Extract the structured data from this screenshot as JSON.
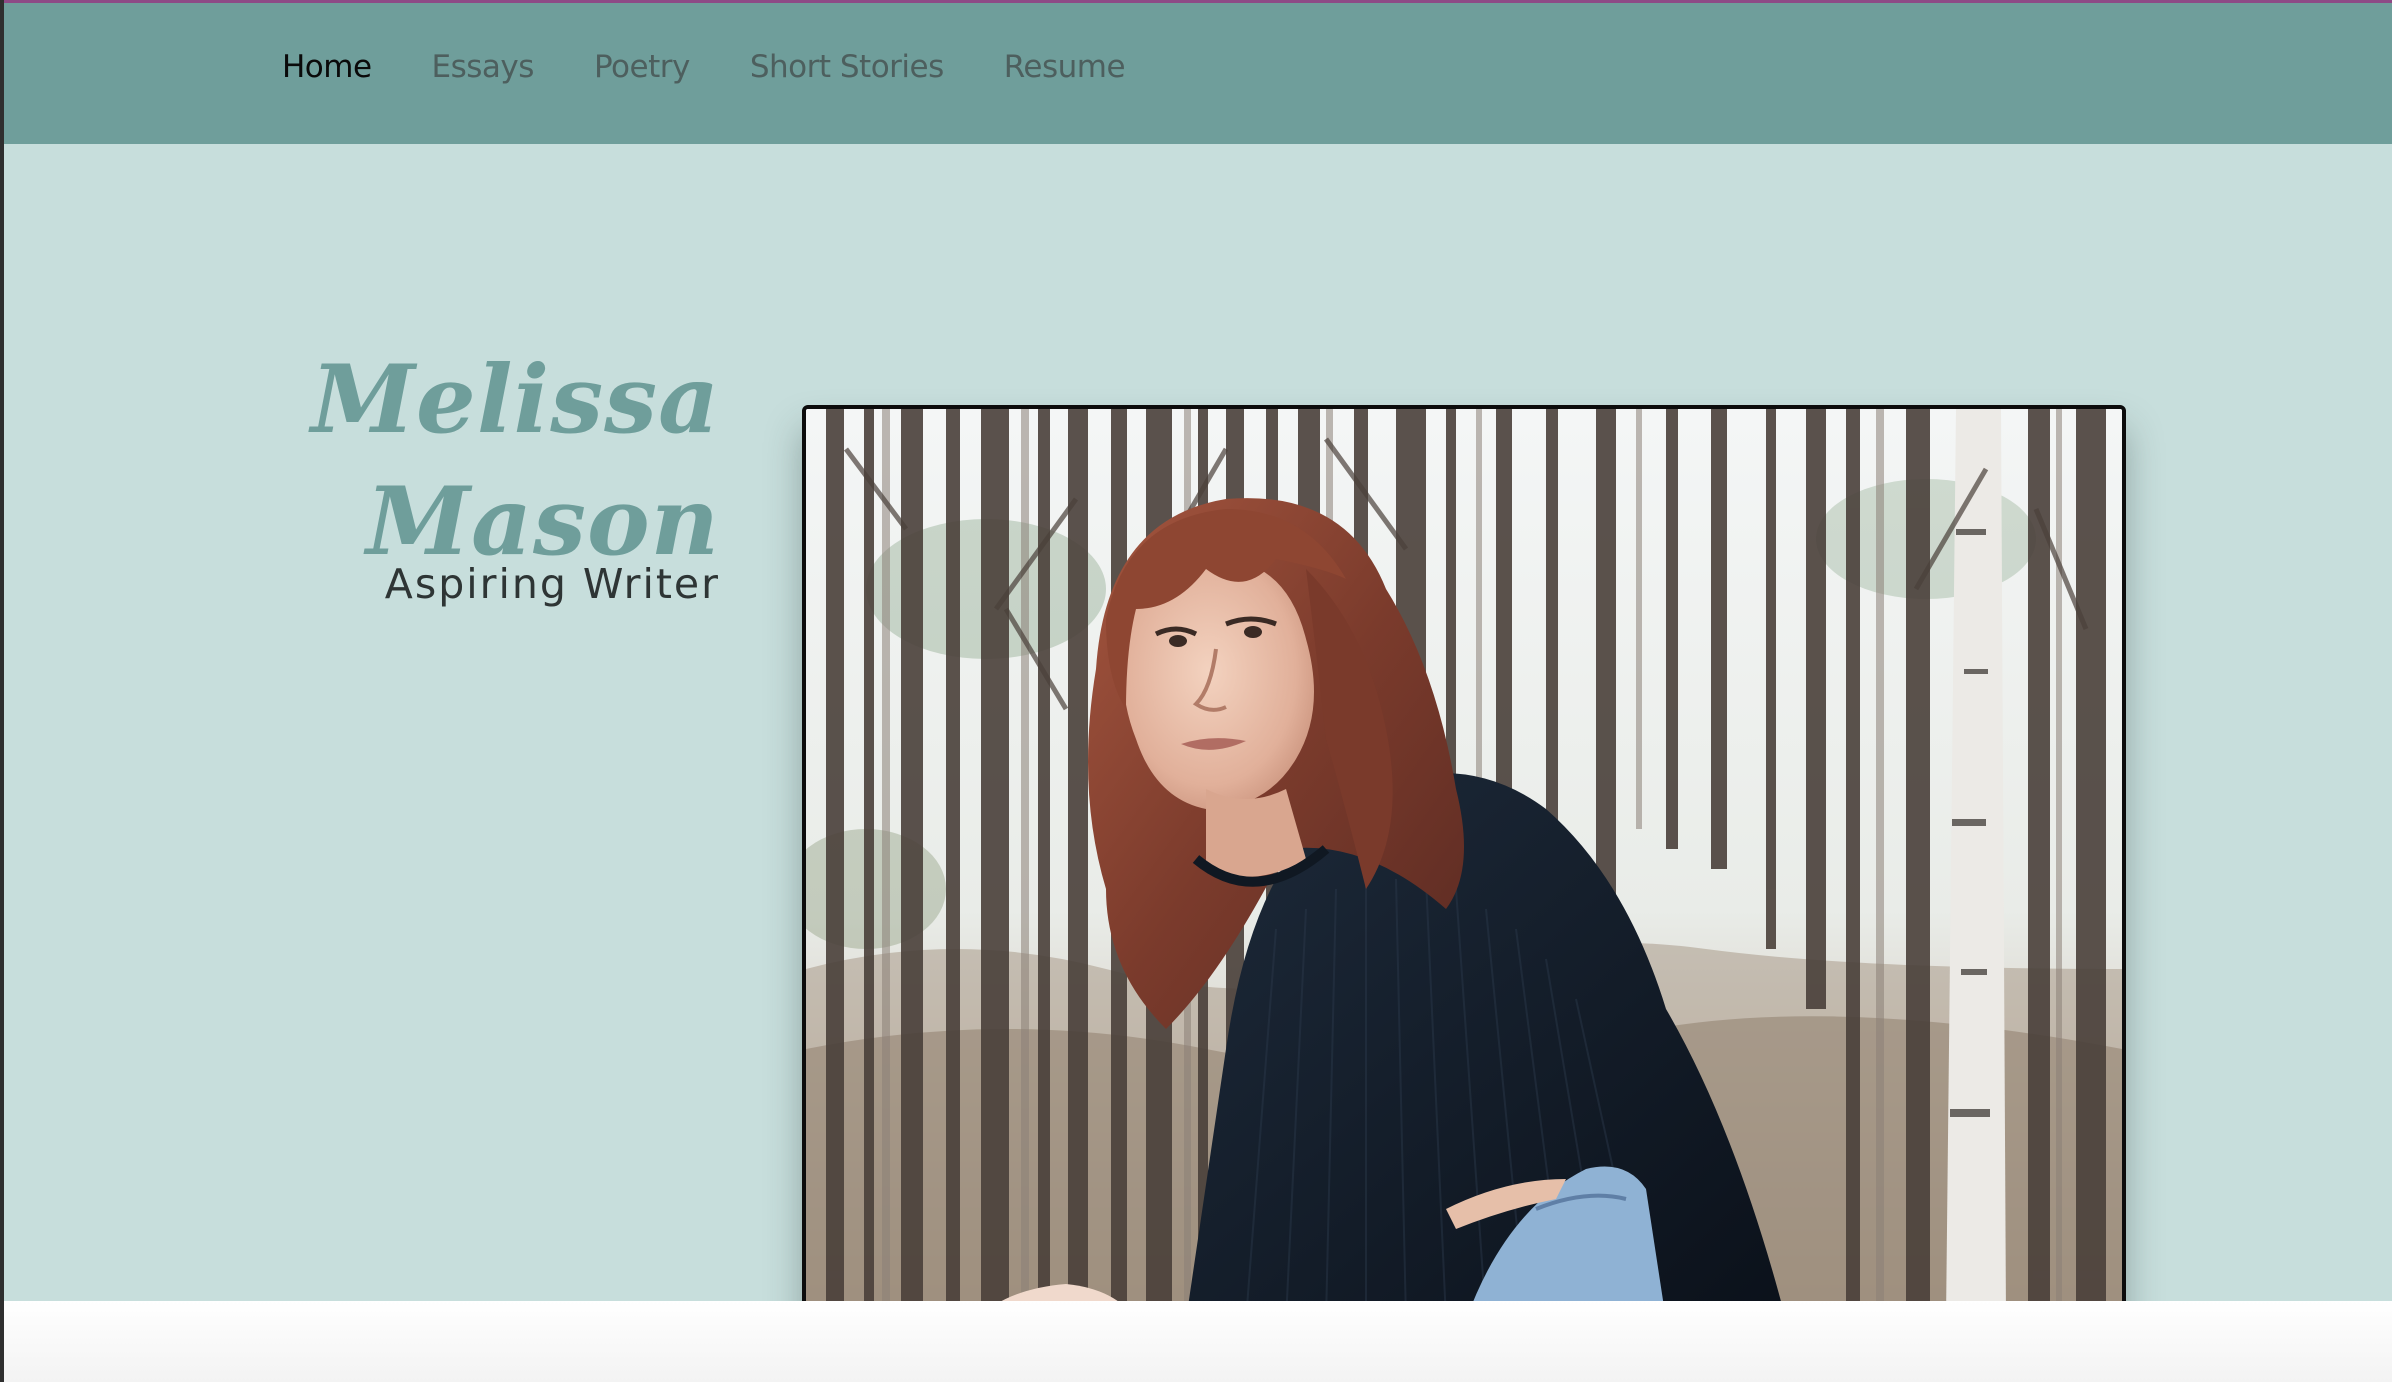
{
  "nav": {
    "items": [
      {
        "label": "Home",
        "active": true
      },
      {
        "label": "Essays",
        "active": false
      },
      {
        "label": "Poetry",
        "active": false
      },
      {
        "label": "Short Stories",
        "active": false
      },
      {
        "label": "Resume",
        "active": false
      }
    ]
  },
  "hero": {
    "name_line1": "Melissa",
    "name_line2": "Mason",
    "tagline": "Aspiring Writer"
  },
  "colors": {
    "nav_bg": "#6f9e9b",
    "hero_bg": "#c7dedc",
    "accent_name": "#6f9e9b",
    "active_link": "#0a0a0a",
    "inactive_link": "#4d5f5e"
  }
}
